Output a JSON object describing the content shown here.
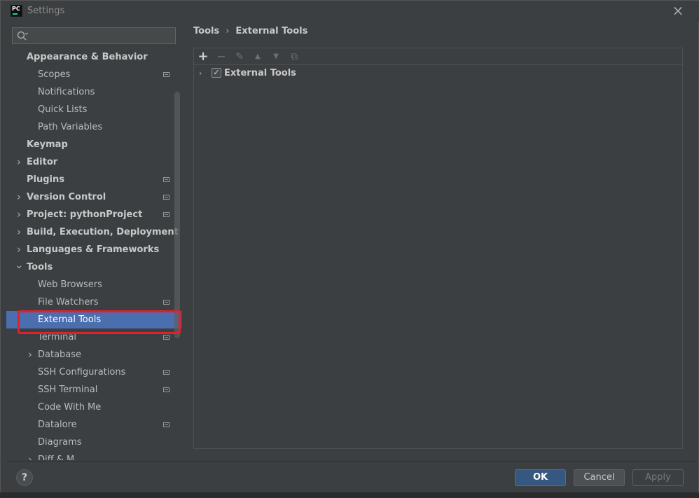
{
  "window": {
    "title": "Settings",
    "logo_text": "PC",
    "close_symbol": "×"
  },
  "search": {
    "placeholder": "",
    "value": "",
    "icon": "search-icon"
  },
  "tree": [
    {
      "label": "Appearance & Behavior",
      "level": 0,
      "expandable": false,
      "modified": false
    },
    {
      "label": "Scopes",
      "level": 1,
      "expandable": false,
      "modified": true
    },
    {
      "label": "Notifications",
      "level": 1,
      "expandable": false,
      "modified": false
    },
    {
      "label": "Quick Lists",
      "level": 1,
      "expandable": false,
      "modified": false
    },
    {
      "label": "Path Variables",
      "level": 1,
      "expandable": false,
      "modified": false
    },
    {
      "label": "Keymap",
      "level": 0,
      "expandable": false,
      "modified": false
    },
    {
      "label": "Editor",
      "level": 0,
      "expandable": true,
      "expanded": false,
      "modified": false
    },
    {
      "label": "Plugins",
      "level": 0,
      "expandable": false,
      "modified": true
    },
    {
      "label": "Version Control",
      "level": 0,
      "expandable": true,
      "expanded": false,
      "modified": true
    },
    {
      "label": "Project: pythonProject",
      "level": 0,
      "expandable": true,
      "expanded": false,
      "modified": true
    },
    {
      "label": "Build, Execution, Deployment",
      "level": 0,
      "expandable": true,
      "expanded": false,
      "modified": false
    },
    {
      "label": "Languages & Frameworks",
      "level": 0,
      "expandable": true,
      "expanded": false,
      "modified": false
    },
    {
      "label": "Tools",
      "level": 0,
      "expandable": true,
      "expanded": true,
      "modified": false
    },
    {
      "label": "Web Browsers",
      "level": 1,
      "expandable": false,
      "modified": false
    },
    {
      "label": "File Watchers",
      "level": 1,
      "expandable": false,
      "modified": true
    },
    {
      "label": "External Tools",
      "level": 1,
      "expandable": false,
      "modified": false,
      "selected": true
    },
    {
      "label": "Terminal",
      "level": 1,
      "expandable": false,
      "modified": true
    },
    {
      "label": "Database",
      "level": 1,
      "expandable": true,
      "expanded": false,
      "modified": false
    },
    {
      "label": "SSH Configurations",
      "level": 1,
      "expandable": false,
      "modified": true
    },
    {
      "label": "SSH Terminal",
      "level": 1,
      "expandable": false,
      "modified": true
    },
    {
      "label": "Code With Me",
      "level": 1,
      "expandable": false,
      "modified": false
    },
    {
      "label": "Datalore",
      "level": 1,
      "expandable": false,
      "modified": true
    },
    {
      "label": "Diagrams",
      "level": 1,
      "expandable": false,
      "modified": false
    },
    {
      "label": "Diff & M…",
      "level": 1,
      "expandable": true,
      "expanded": false,
      "modified": false
    }
  ],
  "breadcrumb": {
    "parent": "Tools",
    "separator": "›",
    "current": "External Tools"
  },
  "toolbar": {
    "add": "+",
    "remove": "−",
    "edit": "✎",
    "move_up": "▲",
    "move_down": "▼",
    "copy": "⧉"
  },
  "tool_group": {
    "label": "External Tools",
    "checked": true,
    "check_symbol": "✓",
    "expand_symbol": "›"
  },
  "footer": {
    "help": "?",
    "ok": "OK",
    "cancel": "Cancel",
    "apply": "Apply"
  },
  "colors": {
    "selection": "#4b6eaf",
    "highlight_box": "#e0202a",
    "ok_button": "#365880",
    "background": "#3c3f41"
  }
}
